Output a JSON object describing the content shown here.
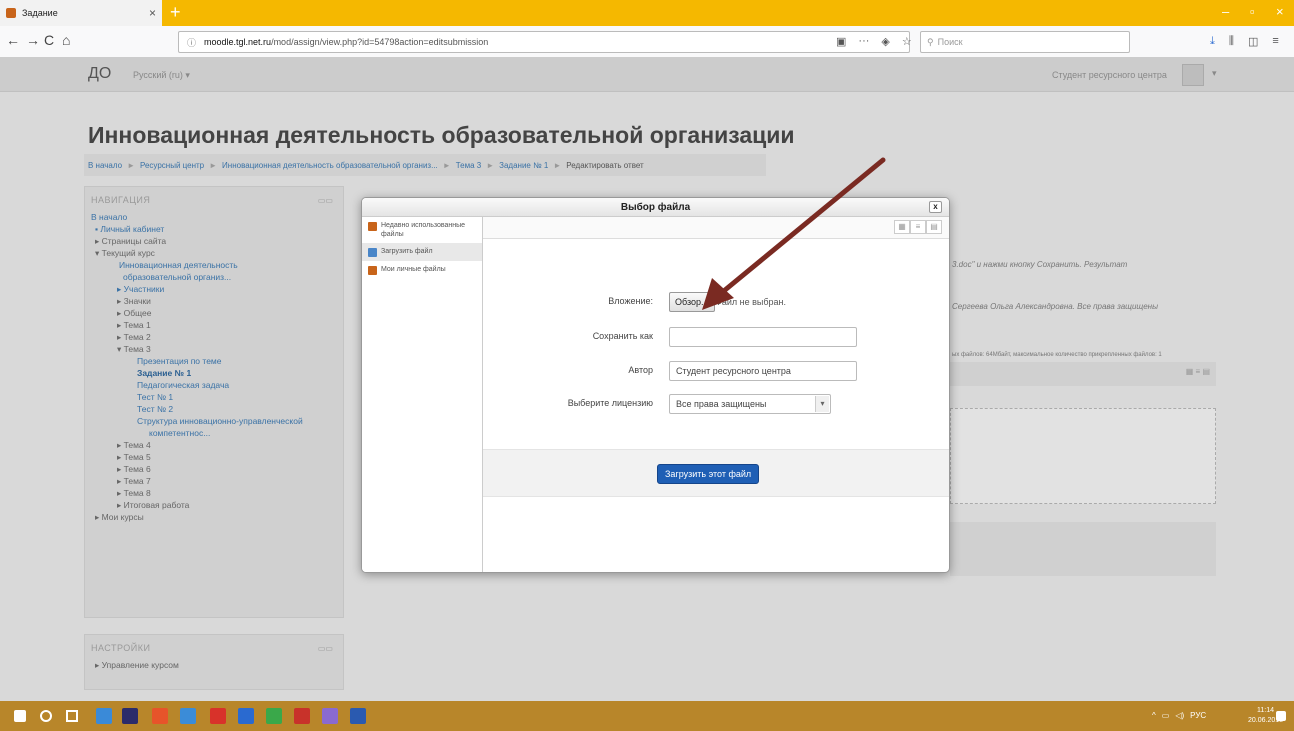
{
  "browser": {
    "tab_title": "Задание",
    "tab_close": "×",
    "new_tab": "+",
    "url": "moodle.tgl.net.ru/mod/assign/view.php?id=54798action=editsubmission",
    "url_host": "moodle.tgl.net.ru",
    "url_path": "/mod/assign/view.php?id=54798action=editsubmission",
    "search_placeholder": "Поиск",
    "back": "←",
    "forward": "→",
    "reload": "C",
    "home": "⌂"
  },
  "header": {
    "brand": "ДО",
    "language": "Русский (ru) ▾",
    "user_name": "Студент ресурсного центра"
  },
  "page": {
    "title": "Инновационная деятельность образовательной организации",
    "breadcrumb": [
      "В начало",
      "Ресурсный центр",
      "Инновационная деятельность образовательной организ...",
      "Тема 3",
      "Задание № 1",
      "Редактировать ответ"
    ]
  },
  "navigation": {
    "title": "НАВИГАЦИЯ",
    "items": [
      "В начало",
      "▪ Личный кабинет",
      "▸ Страницы сайта",
      "▾ Текущий курс",
      "Инновационная деятельность",
      "образовательной организ...",
      "▸ Участники",
      "▸ Значки",
      "▸ Общее",
      "▸ Тема 1",
      "▸ Тема 2",
      "▾ Тема 3",
      "Презентация по теме",
      "Задание № 1",
      "Педагогическая задача",
      "Тест № 1",
      "Тест № 2",
      "Структура инновационно-управленческой",
      "компетентнос...",
      "▸ Тема 4",
      "▸ Тема 5",
      "▸ Тема 6",
      "▸ Тема 7",
      "▸ Тема 8",
      "▸ Итоговая работа",
      "▸ Мои курсы"
    ]
  },
  "settings": {
    "title": "НАСТРОЙКИ",
    "items": [
      "▸ Управление курсом"
    ]
  },
  "background_text": {
    "instruction": "3.doc\" и нажми кнопку Сохранить. Результат",
    "rights": "Сергеева Ольга Александровна. Все права защищены",
    "limits": "ых файлов: 64Мбайт, максимальное количество прикрепленных файлов: 1"
  },
  "dialog": {
    "title": "Выбор файла",
    "close": "x",
    "repositories": [
      "Недавно использованные файлы",
      "Загрузить файл",
      "Мои личные файлы"
    ],
    "attachment_label": "Вложение:",
    "browse_label": "Обзор...",
    "no_file": "Файл не выбран.",
    "save_as_label": "Сохранить как",
    "save_as_value": "",
    "author_label": "Автор",
    "author_value": "Студент ресурсного центра",
    "license_label": "Выберите лицензию",
    "license_value": "Все права защищены",
    "upload_label": "Загрузить этот файл"
  },
  "taskbar": {
    "language": "РУС",
    "time": "11:14",
    "date": "20.06.2018"
  },
  "colors": {
    "titlebar": "#f5b800",
    "taskbar": "#b8862a",
    "primary_button": "#1f5fb5",
    "arrow": "#7a2a22",
    "link": "#3a72a6"
  }
}
